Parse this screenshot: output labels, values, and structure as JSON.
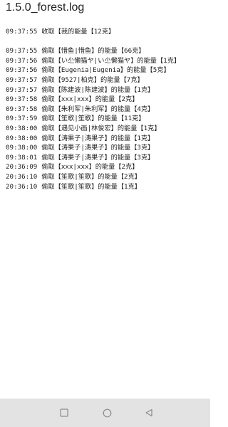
{
  "app": {
    "title": "1.5.0_forest.log"
  },
  "log": {
    "lines": [
      {
        "time": "09:37:55",
        "text": "收取【我的能量【12克】"
      },
      {
        "time": "09:37:55",
        "text": "偷取【惜鱼|惜鱼】的能量【66克】"
      },
      {
        "time": "09:37:56",
        "text": "偷取【い尐懒猫ヤ|い尐懒猫ヤ】的能量【1克】"
      },
      {
        "time": "09:37:56",
        "text": "偷取【Eugenia|Eugenia】的能量【5克】"
      },
      {
        "time": "09:37:57",
        "text": "偷取【9527|柏克】的能量【7克】"
      },
      {
        "time": "09:37:57",
        "text": "偷取【陈建波|陈建波】的能量【1克】"
      },
      {
        "time": "09:37:58",
        "text": "偷取【xxx|xxx】的能量【2克】"
      },
      {
        "time": "09:37:58",
        "text": "偷取【朱利军|朱利军】的能量【4克】"
      },
      {
        "time": "09:37:59",
        "text": "偷取【笙歌|笙歌】的能量【11克】"
      },
      {
        "time": "09:38:00",
        "text": "偷取【遇见小画|林俊宏】的能量【1克】"
      },
      {
        "time": "09:38:00",
        "text": "偷取【涛果子|涛果子】的能量【1克】"
      },
      {
        "time": "09:38:00",
        "text": "偷取【涛果子|涛果子】的能量【3克】"
      },
      {
        "time": "09:38:01",
        "text": "偷取【涛果子|涛果子】的能量【3克】"
      },
      {
        "time": "20:36:09",
        "text": "偷取【xxx|xxx】的能量【2克】"
      },
      {
        "time": "20:36:10",
        "text": "偷取【笙歌|笙歌】的能量【2克】"
      },
      {
        "time": "20:36:10",
        "text": "偷取【笙歌|笙歌】的能量【1克】"
      }
    ]
  },
  "navbar": {
    "recents_icon": "square-icon",
    "home_icon": "circle-icon",
    "back_icon": "triangle-back-icon",
    "icon_color": "#8a8a8a",
    "background": "#e3e3e3"
  }
}
